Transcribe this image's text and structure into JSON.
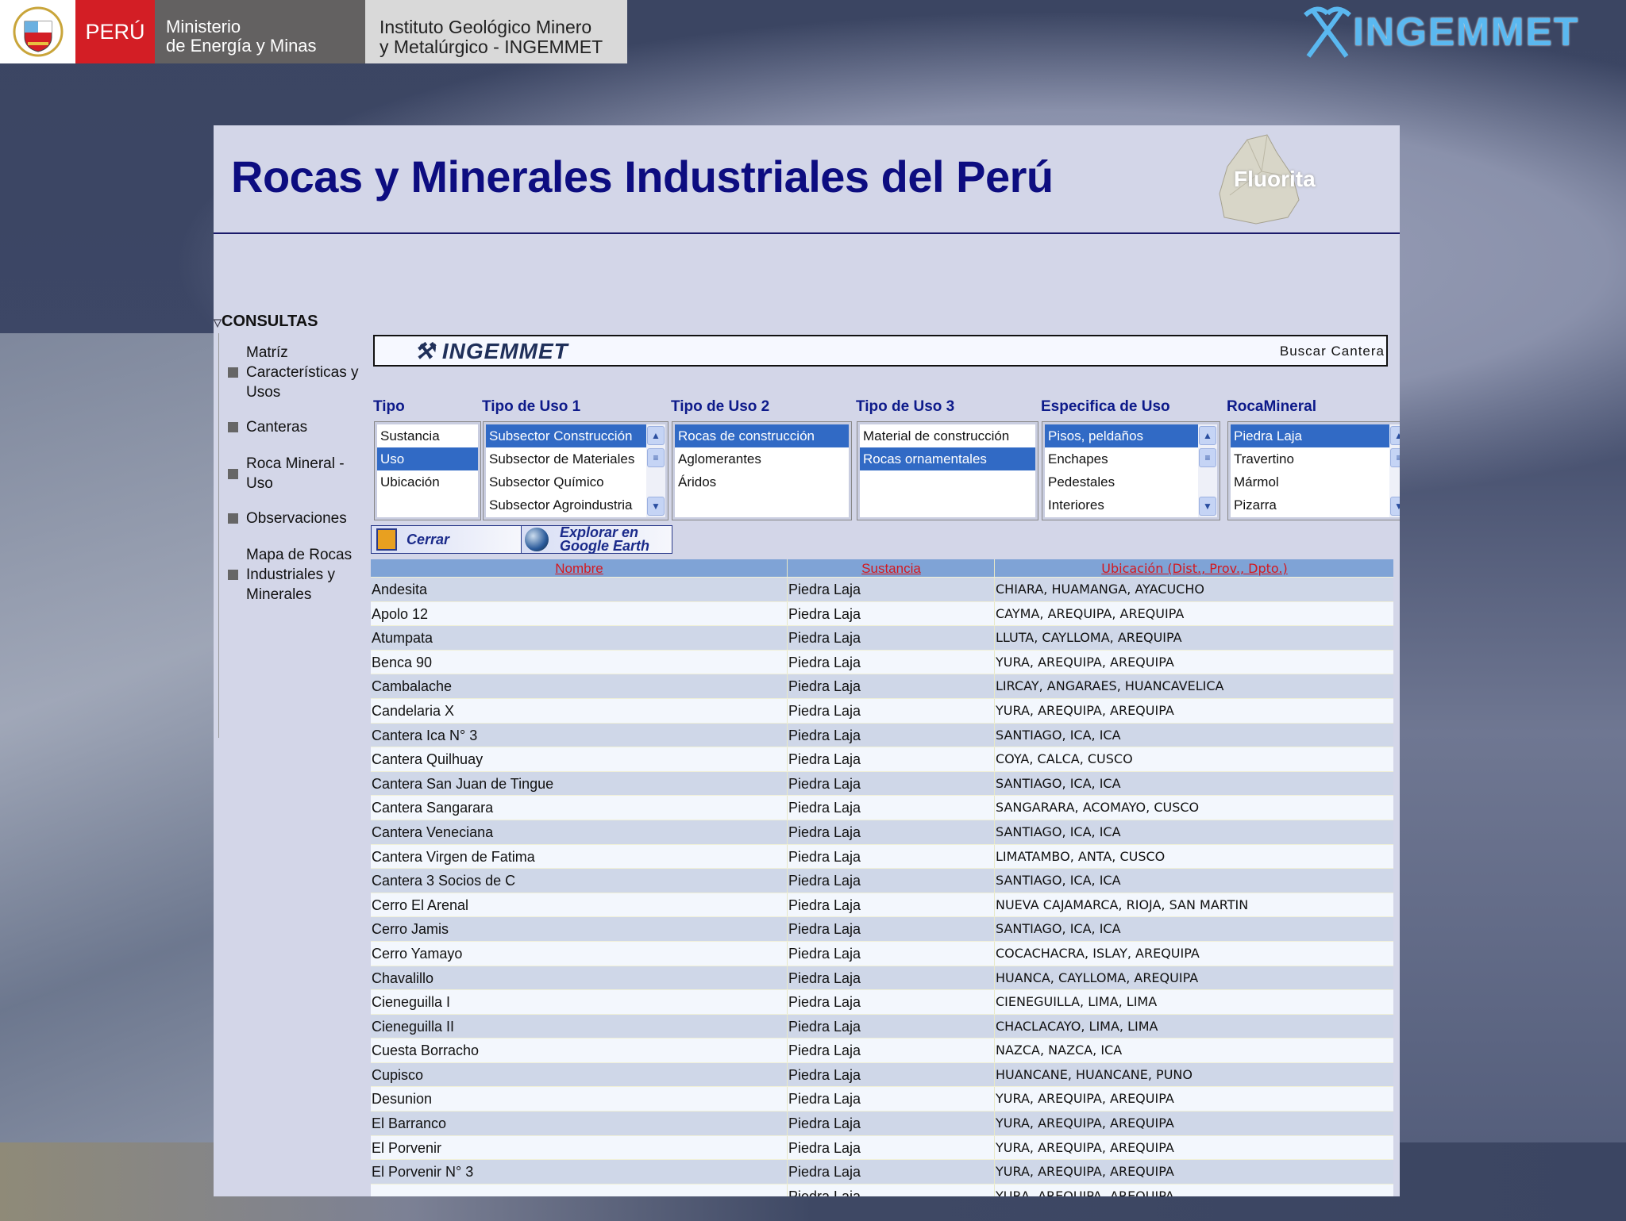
{
  "header": {
    "country": "PERÚ",
    "ministry_line1": "Ministerio",
    "ministry_line2": "de Energía y Minas",
    "institute_line1": "Instituto Geológico Minero",
    "institute_line2": "y Metalúrgico - INGEMMET",
    "brand": "INGEMMET"
  },
  "page": {
    "title": "Rocas y Minerales Industriales del Perú",
    "mineral_label": "Fluorita"
  },
  "sidebar": {
    "heading": "CONSULTAS",
    "items": [
      {
        "label": "Matríz Características y Usos"
      },
      {
        "label": "Canteras"
      },
      {
        "label": "Roca Mineral - Uso"
      },
      {
        "label": "Observaciones"
      },
      {
        "label": "Mapa de Rocas Industriales y Minerales"
      }
    ]
  },
  "banner": {
    "brand": "INGEMMET",
    "search_label": "Buscar Cantera"
  },
  "filters": [
    {
      "label": "Tipo",
      "options": [
        "Sustancia",
        "Uso",
        "Ubicación"
      ],
      "selected": [
        1
      ]
    },
    {
      "label": "Tipo de Uso 1",
      "options": [
        "Subsector Construcción",
        "Subsector de Materiales",
        "Subsector Químico",
        "Subsector Agroindustria"
      ],
      "selected": [
        0
      ]
    },
    {
      "label": "Tipo de Uso 2",
      "options": [
        "Rocas de construcción",
        "Aglomerantes",
        "Áridos"
      ],
      "selected": [
        0
      ]
    },
    {
      "label": "Tipo de Uso 3",
      "options": [
        "Material de construcción",
        "Rocas ornamentales"
      ],
      "selected": [
        1
      ]
    },
    {
      "label": "Especifica de Uso",
      "options": [
        "Pisos, peldaños",
        "Enchapes",
        "Pedestales",
        "Interiores"
      ],
      "selected": [
        0
      ]
    },
    {
      "label": "RocaMineral",
      "options": [
        "Piedra Laja",
        "Travertino",
        "Mármol",
        "Pizarra"
      ],
      "selected": [
        0
      ]
    }
  ],
  "buttons": {
    "close": "Cerrar",
    "google_earth": "Explorar en Google Earth"
  },
  "table": {
    "columns": [
      "Nombre",
      "Sustancia",
      "Ubicación (Dist., Prov., Dpto.)"
    ],
    "rows": [
      [
        "Andesita",
        "Piedra Laja",
        "CHIARA, HUAMANGA, AYACUCHO"
      ],
      [
        "Apolo 12",
        "Piedra Laja",
        "CAYMA, AREQUIPA, AREQUIPA"
      ],
      [
        "Atumpata",
        "Piedra Laja",
        "LLUTA, CAYLLOMA, AREQUIPA"
      ],
      [
        "Benca 90",
        "Piedra Laja",
        "YURA, AREQUIPA, AREQUIPA"
      ],
      [
        "Cambalache",
        "Piedra Laja",
        "LIRCAY, ANGARAES, HUANCAVELICA"
      ],
      [
        "Candelaria X",
        "Piedra Laja",
        "YURA, AREQUIPA, AREQUIPA"
      ],
      [
        "Cantera Ica N° 3",
        "Piedra Laja",
        "SANTIAGO, ICA, ICA"
      ],
      [
        "Cantera Quilhuay",
        "Piedra Laja",
        "COYA, CALCA, CUSCO"
      ],
      [
        "Cantera San Juan de Tingue",
        "Piedra Laja",
        "SANTIAGO, ICA, ICA"
      ],
      [
        "Cantera Sangarara",
        "Piedra Laja",
        "SANGARARA, ACOMAYO, CUSCO"
      ],
      [
        "Cantera Veneciana",
        "Piedra Laja",
        "SANTIAGO, ICA, ICA"
      ],
      [
        "Cantera Virgen de Fatima",
        "Piedra Laja",
        "LIMATAMBO, ANTA, CUSCO"
      ],
      [
        "Cantera 3 Socios de C",
        "Piedra Laja",
        "SANTIAGO, ICA, ICA"
      ],
      [
        "Cerro El Arenal",
        "Piedra Laja",
        "NUEVA CAJAMARCA, RIOJA, SAN MARTIN"
      ],
      [
        "Cerro Jamis",
        "Piedra Laja",
        "SANTIAGO, ICA, ICA"
      ],
      [
        "Cerro Yamayo",
        "Piedra Laja",
        "COCACHACRA, ISLAY, AREQUIPA"
      ],
      [
        "Chavalillo",
        "Piedra Laja",
        "HUANCA, CAYLLOMA, AREQUIPA"
      ],
      [
        "Cieneguilla I",
        "Piedra Laja",
        "CIENEGUILLA, LIMA, LIMA"
      ],
      [
        "Cieneguilla II",
        "Piedra Laja",
        "CHACLACAYO, LIMA, LIMA"
      ],
      [
        "Cuesta Borracho",
        "Piedra Laja",
        "NAZCA, NAZCA, ICA"
      ],
      [
        "Cupisco",
        "Piedra Laja",
        "HUANCANE, HUANCANE, PUNO"
      ],
      [
        "Desunion",
        "Piedra Laja",
        "YURA, AREQUIPA, AREQUIPA"
      ],
      [
        "El Barranco",
        "Piedra Laja",
        "YURA, AREQUIPA, AREQUIPA"
      ],
      [
        "El Porvenir",
        "Piedra Laja",
        "YURA, AREQUIPA, AREQUIPA"
      ],
      [
        "El Porvenir N° 3",
        "Piedra Laja",
        "YURA, AREQUIPA, AREQUIPA"
      ],
      [
        "",
        "Piedra Laja",
        "YURA, AREQUIPA, AREQUIPA"
      ]
    ]
  },
  "colors": {
    "title": "#0d0d80",
    "selection": "#316ac5",
    "header_row": "#7fa3d6",
    "header_text": "#d4181e",
    "peru_red": "#d31e25"
  }
}
